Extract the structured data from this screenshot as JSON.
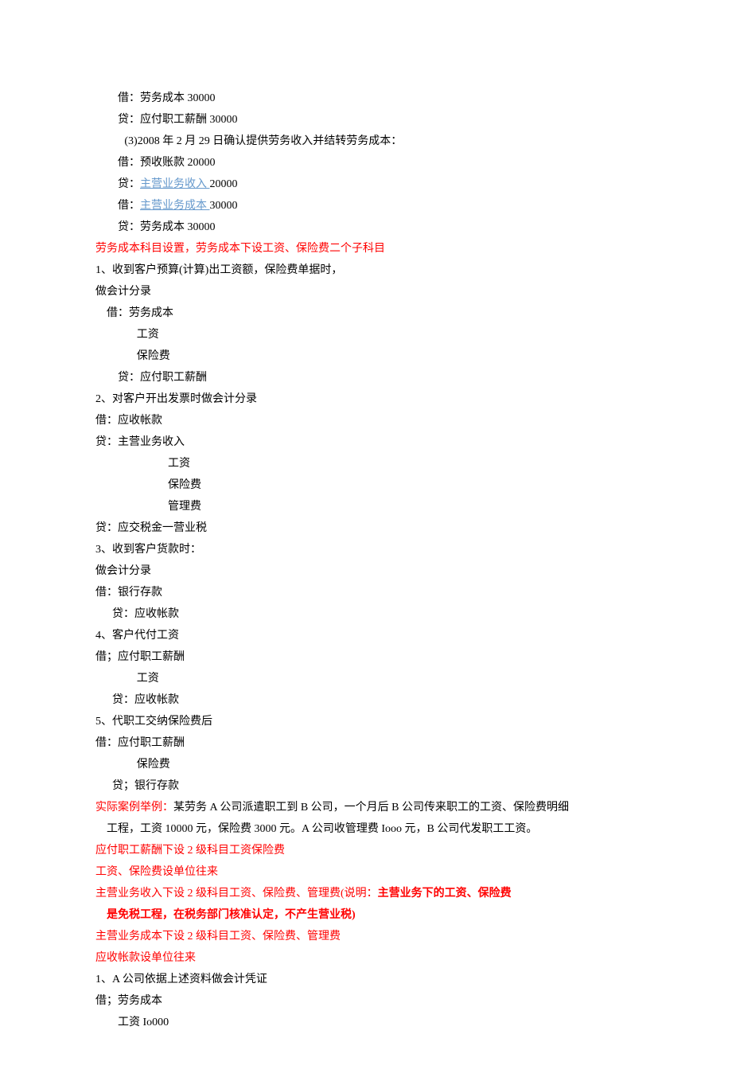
{
  "lines": [
    {
      "indent": "indent1",
      "parts": [
        {
          "text": "借：劳务成本 30000"
        }
      ]
    },
    {
      "indent": "indent1",
      "parts": [
        {
          "text": "贷：应付职工薪酬 30000"
        }
      ]
    },
    {
      "indent": "indent15",
      "parts": [
        {
          "text": "(3)2008 年 2 月 29 日确认提供劳务收入并结转劳务成本："
        }
      ]
    },
    {
      "indent": "indent1",
      "parts": [
        {
          "text": "借：预收账款 20000"
        }
      ]
    },
    {
      "indent": "indent1",
      "parts": [
        {
          "text": "贷："
        },
        {
          "text": "主营业务收入 ",
          "link": true
        },
        {
          "text": "20000"
        }
      ]
    },
    {
      "indent": "indent1",
      "parts": [
        {
          "text": "借："
        },
        {
          "text": "主营业务成本 ",
          "link": true
        },
        {
          "text": "30000"
        }
      ]
    },
    {
      "indent": "indent1",
      "parts": [
        {
          "text": "贷：劳务成本 30000"
        }
      ]
    },
    {
      "indent": "",
      "parts": [
        {
          "text": "劳务成本科目设置，劳务成本下设工资、保险费二个子科目",
          "red": true
        }
      ]
    },
    {
      "indent": "",
      "parts": [
        {
          "text": "1、收到客户预算(计算)出工资额，保险费单据时，"
        }
      ]
    },
    {
      "indent": "",
      "parts": [
        {
          "text": "做会计分录"
        }
      ]
    },
    {
      "indent": "indent05",
      "parts": [
        {
          "text": "借：劳务成本"
        }
      ]
    },
    {
      "indent": "indent2",
      "parts": [
        {
          "text": "工资"
        }
      ]
    },
    {
      "indent": "indent2",
      "parts": [
        {
          "text": "保险费"
        }
      ]
    },
    {
      "indent": "indent1",
      "parts": [
        {
          "text": "贷：应付职工薪酬"
        }
      ]
    },
    {
      "indent": "",
      "parts": [
        {
          "text": "2、对客户开出发票时做会计分录"
        }
      ]
    },
    {
      "indent": "",
      "parts": [
        {
          "text": "借：应收帐款"
        }
      ]
    },
    {
      "indent": "",
      "parts": [
        {
          "text": "贷：主营业务收入"
        }
      ]
    },
    {
      "indent": "indent3",
      "parts": [
        {
          "text": "工资"
        }
      ]
    },
    {
      "indent": "indent3",
      "parts": [
        {
          "text": "保险费"
        }
      ]
    },
    {
      "indent": "indent3",
      "parts": [
        {
          "text": "管理费"
        }
      ]
    },
    {
      "indent": "",
      "parts": [
        {
          "text": "贷：应交税金一营业税"
        }
      ]
    },
    {
      "indent": "",
      "parts": [
        {
          "text": "3、收到客户货款时："
        }
      ]
    },
    {
      "indent": "",
      "parts": [
        {
          "text": "做会计分录"
        }
      ]
    },
    {
      "indent": "",
      "parts": [
        {
          "text": "借：银行存款"
        }
      ]
    },
    {
      "indent": "indent08",
      "parts": [
        {
          "text": "贷：应收帐款"
        }
      ]
    },
    {
      "indent": "",
      "parts": [
        {
          "text": "4、客户代付工资"
        }
      ]
    },
    {
      "indent": "",
      "parts": [
        {
          "text": "借；应付职工薪酬"
        }
      ]
    },
    {
      "indent": "indent2",
      "parts": [
        {
          "text": "工资"
        }
      ]
    },
    {
      "indent": "indent08",
      "parts": [
        {
          "text": "贷：应收帐款"
        }
      ]
    },
    {
      "indent": "",
      "parts": [
        {
          "text": "5、代职工交纳保险费后"
        }
      ]
    },
    {
      "indent": "",
      "parts": [
        {
          "text": "借：应付职工薪酬"
        }
      ]
    },
    {
      "indent": "indent2",
      "parts": [
        {
          "text": "保险费"
        }
      ]
    },
    {
      "indent": "indent08",
      "parts": [
        {
          "text": "贷；银行存款"
        }
      ]
    },
    {
      "indent": "",
      "parts": [
        {
          "text": "实际案例举例：",
          "red": true
        },
        {
          "text": "某劳务 A 公司派遣职工到 B 公司，一个月后 B 公司传来职工的工资、保险费明细"
        }
      ]
    },
    {
      "indent": "indent05",
      "parts": [
        {
          "text": "工程，工资 10000 元，保险费 3000 元。A 公司收管理费 Iooo 元，B 公司代发职工工资。"
        }
      ]
    },
    {
      "indent": "",
      "parts": [
        {
          "text": "应付职工薪酬下设 2 级科目工资保险费",
          "red": true
        }
      ]
    },
    {
      "indent": "",
      "parts": [
        {
          "text": "工资、保险费设单位往来",
          "red": true
        }
      ]
    },
    {
      "indent": "",
      "parts": [
        {
          "text": "主营业务收入下设 2 级科目工资、保险费、管理费(说明：",
          "red": true
        },
        {
          "text": "主营业务下的工资、保险费",
          "red": true,
          "bold": true
        }
      ]
    },
    {
      "indent": "indent05",
      "parts": [
        {
          "text": "是免税工程，在税务部门核准认定，不产生营业税)",
          "red": true,
          "bold": true
        }
      ]
    },
    {
      "indent": "",
      "parts": [
        {
          "text": "主营业务成本下设 2 级科目工资、保险费、管理费",
          "red": true
        }
      ]
    },
    {
      "indent": "",
      "parts": [
        {
          "text": "应收帐款设单位往来",
          "red": true
        }
      ]
    },
    {
      "indent": "",
      "parts": [
        {
          "text": "1、A 公司依据上述资料做会计凭证"
        }
      ]
    },
    {
      "indent": "",
      "parts": [
        {
          "text": "借；劳务成本"
        }
      ]
    },
    {
      "indent": "indent1",
      "parts": [
        {
          "text": "工资 Io000"
        }
      ]
    }
  ]
}
